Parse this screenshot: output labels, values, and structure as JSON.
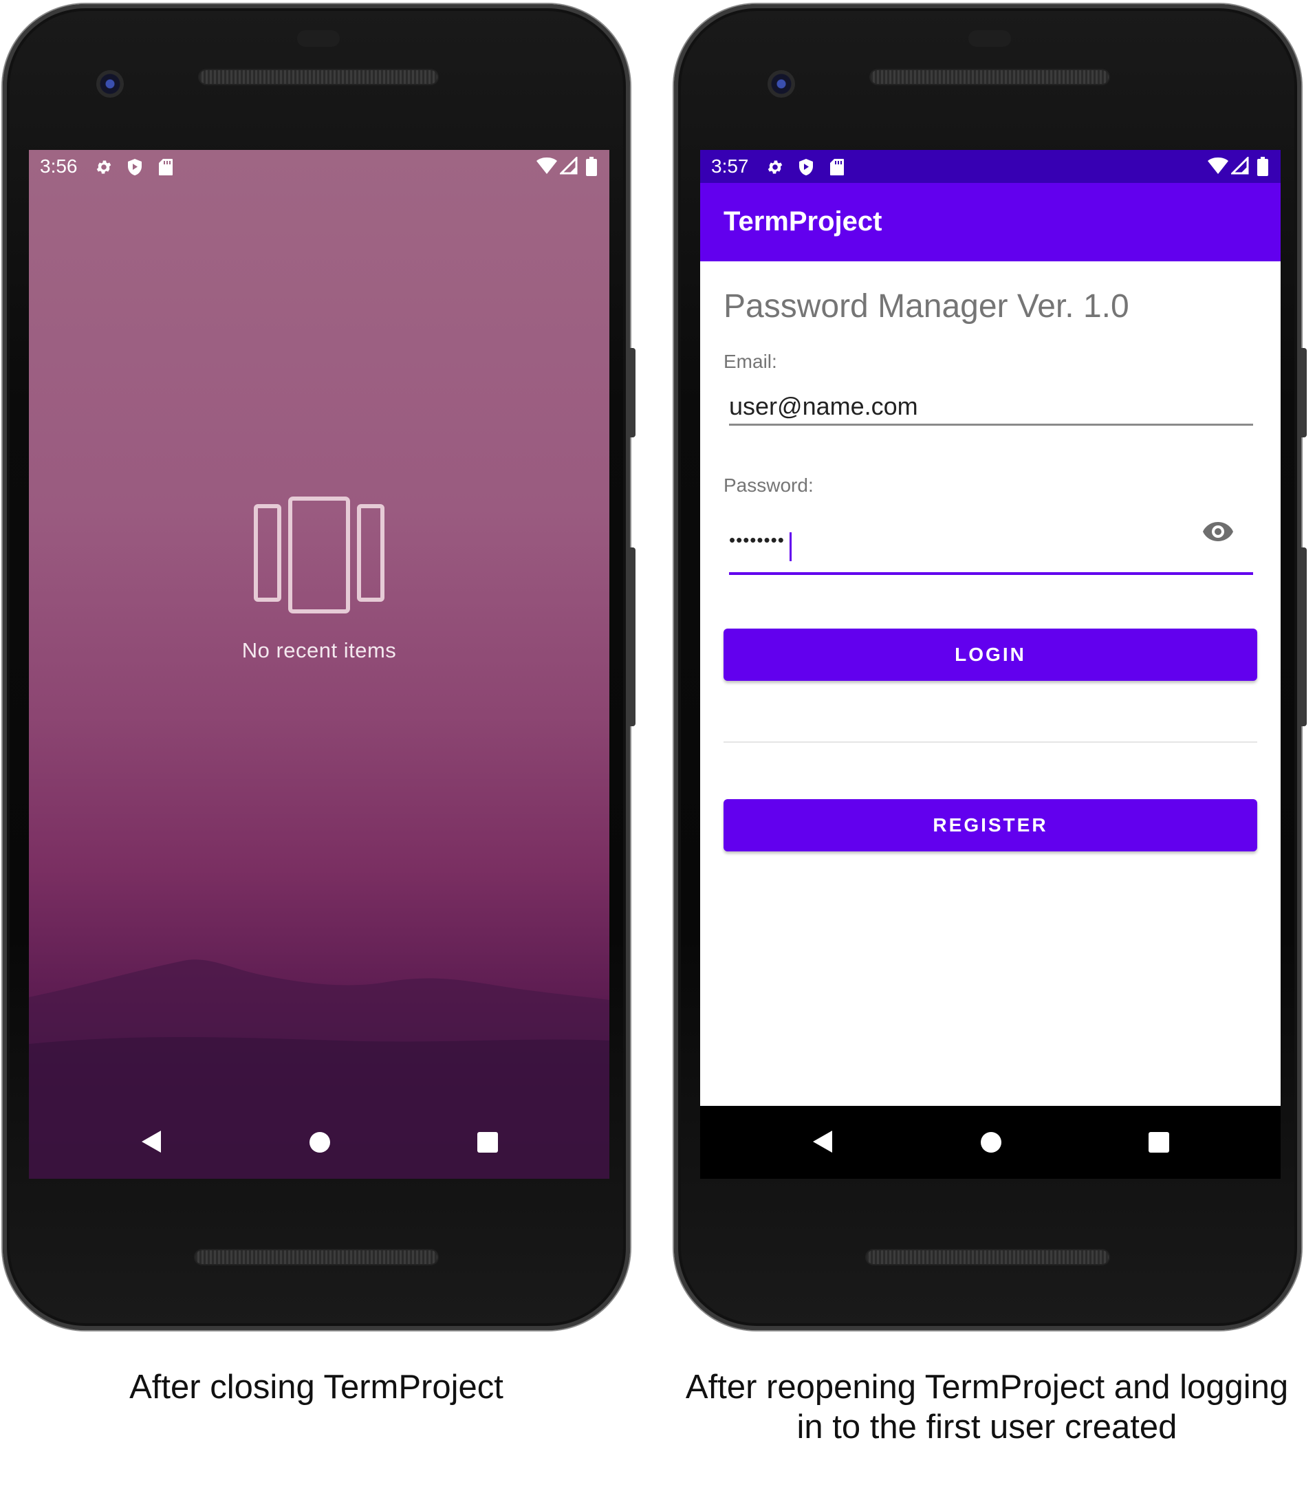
{
  "left_phone": {
    "status_time": "3:56",
    "no_recent_text": "No recent items"
  },
  "right_phone": {
    "status_time": "3:57",
    "app_title": "TermProject",
    "heading": "Password Manager Ver. 1.0",
    "email_label": "Email:",
    "email_value": "user@name.com",
    "password_label": "Password:",
    "password_value": "••••••••",
    "login_label": "LOGIN",
    "register_label": "REGISTER"
  },
  "captions": {
    "left": "After closing TermProject",
    "right_line1": "After reopening TermProject and logging",
    "right_line2": "in to the first user created"
  },
  "colors": {
    "primary": "#6200ee",
    "primary_dark": "#3700b3",
    "wallpaper_top": "#9f6684",
    "wallpaper_bottom": "#2e0d33"
  },
  "icons": [
    "settings-icon",
    "shield-icon",
    "sd-card-icon",
    "wifi-icon",
    "signal-icon",
    "battery-icon",
    "back-icon",
    "home-icon",
    "recents-icon",
    "visibility-icon"
  ]
}
